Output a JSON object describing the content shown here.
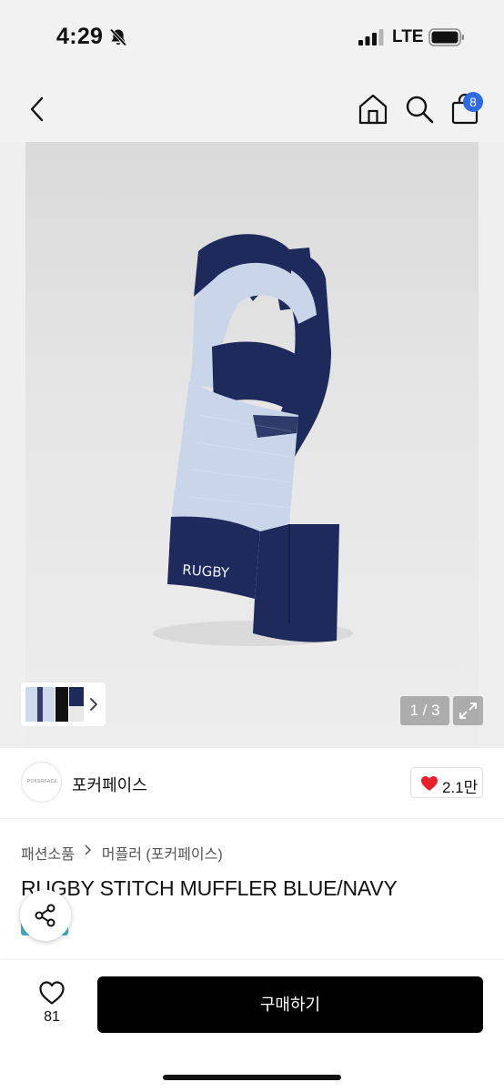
{
  "status_bar": {
    "time": "4:29",
    "network": "LTE",
    "icons": [
      "bell-slash-icon",
      "signal-icon",
      "battery-icon"
    ]
  },
  "nav": {
    "back_icon": "chevron-left-icon",
    "home_icon": "home-icon",
    "search_icon": "search-icon",
    "bag_icon": "shopping-bag-icon",
    "bag_count": "8",
    "badge_color": "#2d6be4"
  },
  "gallery": {
    "page_indicator": "1 / 3",
    "expand_icon": "expand-icon",
    "thumbnail_count": 3,
    "scarf_text": "RUGBY",
    "scarf_colors": {
      "navy": "#1e2a5c",
      "light_blue": "#c9d6ea"
    }
  },
  "seller": {
    "avatar_text": "POKERFACE",
    "name": "포커페이스",
    "likes": "2.1만",
    "heart_color": "#e8202a"
  },
  "product": {
    "breadcrumb": [
      "패션소품",
      "머플러 (포커페이스)"
    ],
    "title": "RUGBY STITCH MUFFLER BLUE/NAVY"
  },
  "bottom_bar": {
    "wish_count": "81",
    "buy_label": "구매하기"
  }
}
